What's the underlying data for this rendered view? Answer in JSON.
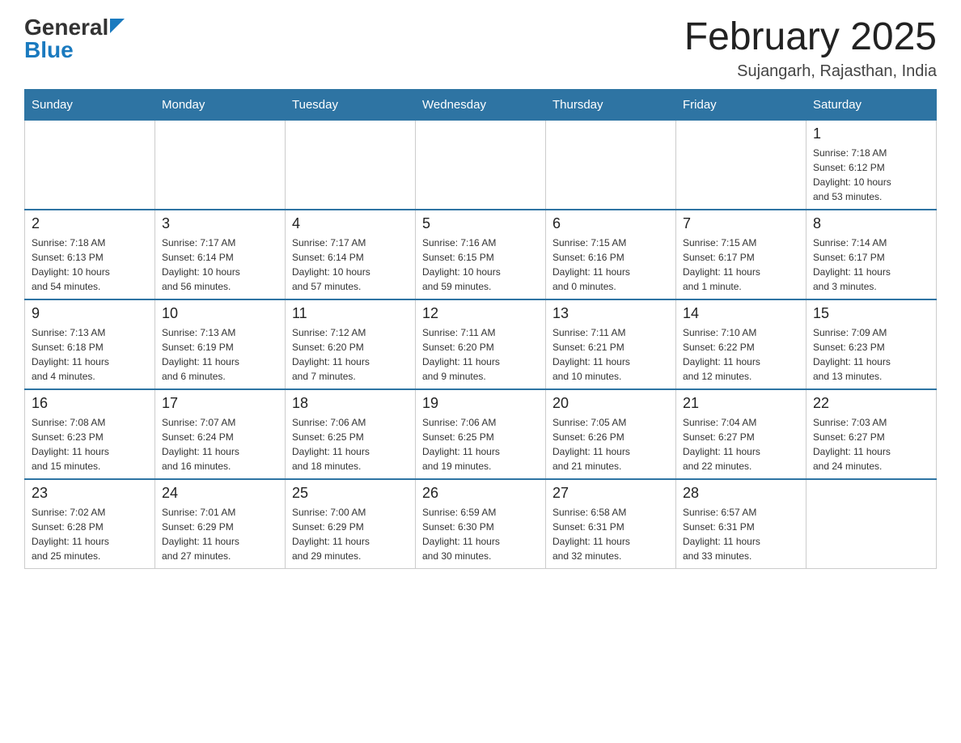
{
  "logo": {
    "general": "General",
    "blue": "Blue"
  },
  "title": "February 2025",
  "location": "Sujangarh, Rajasthan, India",
  "days_of_week": [
    "Sunday",
    "Monday",
    "Tuesday",
    "Wednesday",
    "Thursday",
    "Friday",
    "Saturday"
  ],
  "weeks": [
    [
      {
        "date": "",
        "info": ""
      },
      {
        "date": "",
        "info": ""
      },
      {
        "date": "",
        "info": ""
      },
      {
        "date": "",
        "info": ""
      },
      {
        "date": "",
        "info": ""
      },
      {
        "date": "",
        "info": ""
      },
      {
        "date": "1",
        "info": "Sunrise: 7:18 AM\nSunset: 6:12 PM\nDaylight: 10 hours\nand 53 minutes."
      }
    ],
    [
      {
        "date": "2",
        "info": "Sunrise: 7:18 AM\nSunset: 6:13 PM\nDaylight: 10 hours\nand 54 minutes."
      },
      {
        "date": "3",
        "info": "Sunrise: 7:17 AM\nSunset: 6:14 PM\nDaylight: 10 hours\nand 56 minutes."
      },
      {
        "date": "4",
        "info": "Sunrise: 7:17 AM\nSunset: 6:14 PM\nDaylight: 10 hours\nand 57 minutes."
      },
      {
        "date": "5",
        "info": "Sunrise: 7:16 AM\nSunset: 6:15 PM\nDaylight: 10 hours\nand 59 minutes."
      },
      {
        "date": "6",
        "info": "Sunrise: 7:15 AM\nSunset: 6:16 PM\nDaylight: 11 hours\nand 0 minutes."
      },
      {
        "date": "7",
        "info": "Sunrise: 7:15 AM\nSunset: 6:17 PM\nDaylight: 11 hours\nand 1 minute."
      },
      {
        "date": "8",
        "info": "Sunrise: 7:14 AM\nSunset: 6:17 PM\nDaylight: 11 hours\nand 3 minutes."
      }
    ],
    [
      {
        "date": "9",
        "info": "Sunrise: 7:13 AM\nSunset: 6:18 PM\nDaylight: 11 hours\nand 4 minutes."
      },
      {
        "date": "10",
        "info": "Sunrise: 7:13 AM\nSunset: 6:19 PM\nDaylight: 11 hours\nand 6 minutes."
      },
      {
        "date": "11",
        "info": "Sunrise: 7:12 AM\nSunset: 6:20 PM\nDaylight: 11 hours\nand 7 minutes."
      },
      {
        "date": "12",
        "info": "Sunrise: 7:11 AM\nSunset: 6:20 PM\nDaylight: 11 hours\nand 9 minutes."
      },
      {
        "date": "13",
        "info": "Sunrise: 7:11 AM\nSunset: 6:21 PM\nDaylight: 11 hours\nand 10 minutes."
      },
      {
        "date": "14",
        "info": "Sunrise: 7:10 AM\nSunset: 6:22 PM\nDaylight: 11 hours\nand 12 minutes."
      },
      {
        "date": "15",
        "info": "Sunrise: 7:09 AM\nSunset: 6:23 PM\nDaylight: 11 hours\nand 13 minutes."
      }
    ],
    [
      {
        "date": "16",
        "info": "Sunrise: 7:08 AM\nSunset: 6:23 PM\nDaylight: 11 hours\nand 15 minutes."
      },
      {
        "date": "17",
        "info": "Sunrise: 7:07 AM\nSunset: 6:24 PM\nDaylight: 11 hours\nand 16 minutes."
      },
      {
        "date": "18",
        "info": "Sunrise: 7:06 AM\nSunset: 6:25 PM\nDaylight: 11 hours\nand 18 minutes."
      },
      {
        "date": "19",
        "info": "Sunrise: 7:06 AM\nSunset: 6:25 PM\nDaylight: 11 hours\nand 19 minutes."
      },
      {
        "date": "20",
        "info": "Sunrise: 7:05 AM\nSunset: 6:26 PM\nDaylight: 11 hours\nand 21 minutes."
      },
      {
        "date": "21",
        "info": "Sunrise: 7:04 AM\nSunset: 6:27 PM\nDaylight: 11 hours\nand 22 minutes."
      },
      {
        "date": "22",
        "info": "Sunrise: 7:03 AM\nSunset: 6:27 PM\nDaylight: 11 hours\nand 24 minutes."
      }
    ],
    [
      {
        "date": "23",
        "info": "Sunrise: 7:02 AM\nSunset: 6:28 PM\nDaylight: 11 hours\nand 25 minutes."
      },
      {
        "date": "24",
        "info": "Sunrise: 7:01 AM\nSunset: 6:29 PM\nDaylight: 11 hours\nand 27 minutes."
      },
      {
        "date": "25",
        "info": "Sunrise: 7:00 AM\nSunset: 6:29 PM\nDaylight: 11 hours\nand 29 minutes."
      },
      {
        "date": "26",
        "info": "Sunrise: 6:59 AM\nSunset: 6:30 PM\nDaylight: 11 hours\nand 30 minutes."
      },
      {
        "date": "27",
        "info": "Sunrise: 6:58 AM\nSunset: 6:31 PM\nDaylight: 11 hours\nand 32 minutes."
      },
      {
        "date": "28",
        "info": "Sunrise: 6:57 AM\nSunset: 6:31 PM\nDaylight: 11 hours\nand 33 minutes."
      },
      {
        "date": "",
        "info": ""
      }
    ]
  ]
}
